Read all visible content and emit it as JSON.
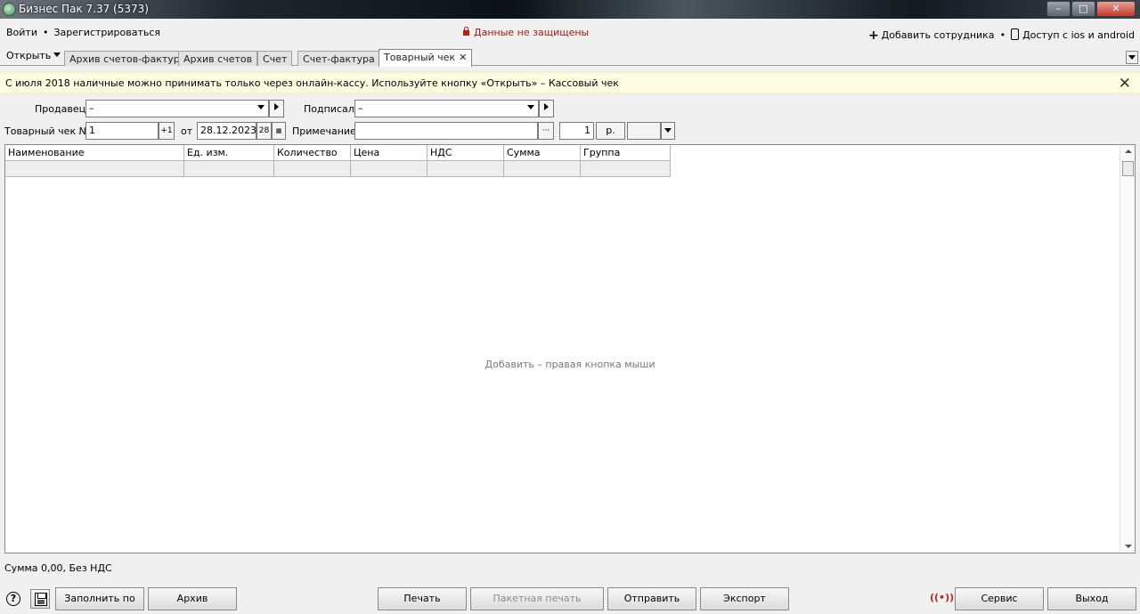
{
  "window": {
    "title": "Бизнес Пак 7.37 (5373)",
    "controls": {
      "minimize": "–",
      "maximize": "□",
      "close": "✕"
    }
  },
  "menu": {
    "login": "Войти",
    "separator": "•",
    "register": "Зарегистрироваться",
    "security_status": "Данные не защищены",
    "add_employee": "Добавить сотрудника",
    "mobile_access": "Доступ с ios и android"
  },
  "tabs": {
    "open_label": "Открыть",
    "items": [
      {
        "label": "Архив счетов-фактур"
      },
      {
        "label": "Архив счетов"
      },
      {
        "label": "Счет"
      },
      {
        "label": "Счет-фактура"
      },
      {
        "label": "Товарный чек",
        "active": true
      }
    ]
  },
  "banner": {
    "text": "С июля 2018 наличные можно принимать только через онлайн-кассу.  Используйте кнопку «Открыть» – Кассовый чек"
  },
  "form": {
    "seller_label": "Продавец",
    "seller_value": "–",
    "signed_label": "Подписал",
    "signed_value": "–",
    "receipt_label": "Товарный чек №",
    "receipt_number": "1",
    "increment_label": "+1",
    "date_from_label": "от",
    "date_value": "28.12.2023",
    "date_day_label": "28",
    "note_label": "Примечание",
    "note_value": "",
    "ellipsis_label": "···",
    "quantity_value": "1",
    "currency_label": "р.",
    "currency_select_value": ""
  },
  "grid": {
    "columns": [
      "Наименование",
      "Ед. изм.",
      "Количество",
      "Цена",
      "НДС",
      "Сумма",
      "Группа"
    ],
    "empty_hint": "Добавить – правая кнопка мыши"
  },
  "status": {
    "sum_text": "Сумма 0,00, Без НДС"
  },
  "toolbar": {
    "help": "?",
    "fill_by": "Заполнить по",
    "archive": "Архив",
    "print": "Печать",
    "batch_print": "Пакетная печать",
    "send": "Отправить",
    "export": "Экспорт",
    "radio": "((•))",
    "service": "Сервис",
    "exit": "Выход"
  }
}
